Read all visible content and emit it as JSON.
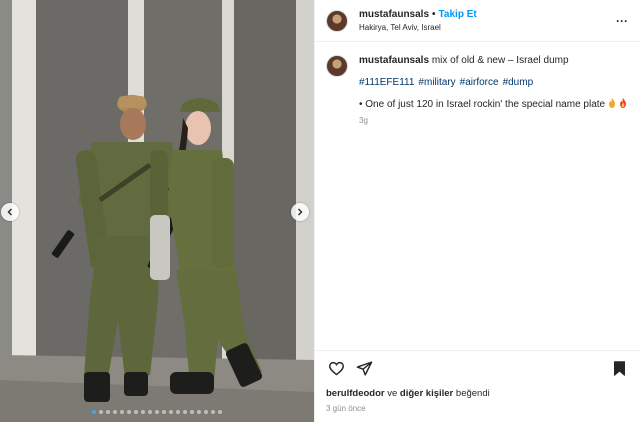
{
  "header": {
    "username": "mustafaunsals",
    "separator": "•",
    "follow_label": "Takip Et",
    "location": "Hakirya, Tel Aviv, Israel",
    "more_icon": "ellipsis-icon"
  },
  "caption": {
    "username": "mustafaunsals",
    "text": "mix of old & new – Israel dump",
    "hashtags": [
      "#111EFE111",
      "#military",
      "#airforce",
      "#dump"
    ],
    "bullet_text": "• One of just 120 in Israel rockin' the special name plate",
    "time": "3g"
  },
  "carousel": {
    "total_slides": 19,
    "active_index": 0
  },
  "likes": {
    "user": "berulfdeodor",
    "connector": "ve",
    "others": "diğer kişiler",
    "suffix": "beğendi"
  },
  "posted_ago": "3 gün önce",
  "colors": {
    "follow": "#0095f6",
    "hashtag": "#00376b",
    "muted": "#8e8e8e",
    "text": "#262626"
  }
}
